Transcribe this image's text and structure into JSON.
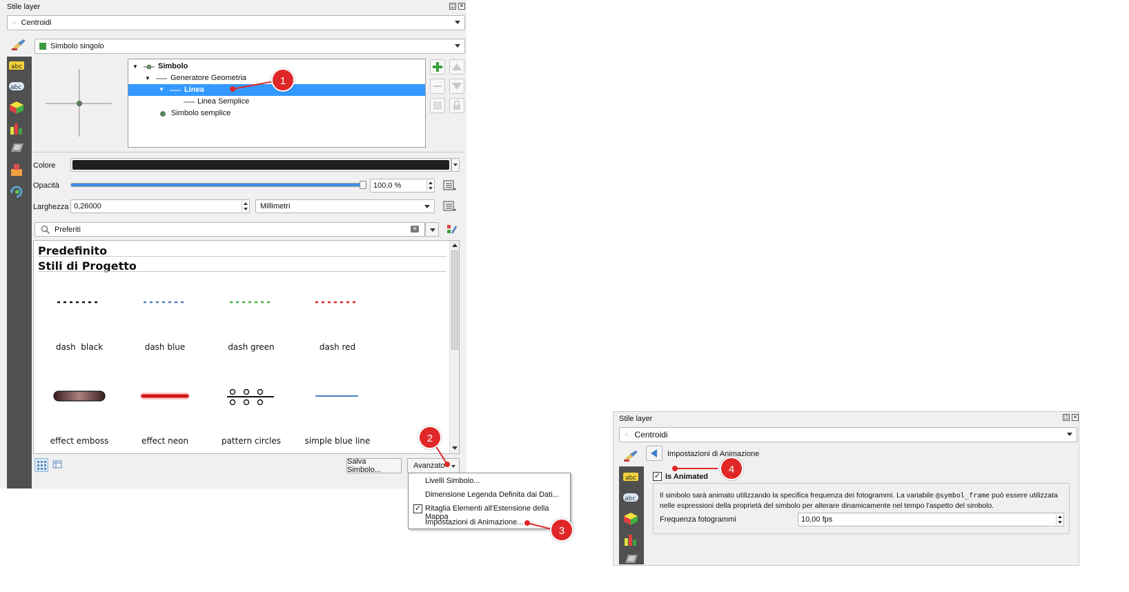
{
  "left_panel": {
    "title": "Stile layer",
    "layer_combo": "Centroidi",
    "renderer_combo": "Simbolo singolo",
    "tree": [
      {
        "label": "Simbolo",
        "bold": true
      },
      {
        "label": "Generatore Geometria"
      },
      {
        "label": "Linea",
        "selected": true
      },
      {
        "label": "Linea Semplice"
      },
      {
        "label": "Simbolo semplice"
      }
    ],
    "colore_label": "Colore",
    "colore_value": "#202020",
    "opacita_label": "Opacità",
    "opacita_value": "100,0 %",
    "opacita_fraction": 1.0,
    "larghezza_label": "Larghezza",
    "larghezza_value": "0,26000",
    "unit_value": "Millimetri",
    "search_value": "Preferiti",
    "groups": [
      "Predefinito",
      "Stili di Progetto"
    ],
    "symbols_row1": [
      "dash  black",
      "dash blue",
      "dash green",
      "dash red"
    ],
    "symbols_row2": [
      "effect emboss",
      "effect neon",
      "pattern circles",
      "simple blue line"
    ],
    "save_symbol": "Salva Simbolo...",
    "advanced": "Avanzato"
  },
  "menu": {
    "items": [
      "Livelli Simbolo...",
      "Dimensione Legenda Definita dai Dati...",
      "Ritaglia Elementi all'Estensione della Mappa",
      "Impostazioni di Animazione..."
    ],
    "checked_index": 2
  },
  "right_panel": {
    "title": "Stile layer",
    "layer_combo": "Centroidi",
    "page_title": "Impostazioni di Animazione",
    "is_animated_label": "Is Animated",
    "is_animated_checked": true,
    "description_1": "Il simbolo sarà animato utilizzando la specifica frequenza dei fotogrammi. La variabile",
    "description_code": "@symbol_frame",
    "description_2": "può essere utilizzata",
    "description_3": "nelle espressioni della proprietà del simbolo per alterare dinamicamente nel tempo l'aspetto del simbolo.",
    "freq_label": "Frequenza fotogrammi",
    "freq_value": "10,00 fps"
  },
  "callouts": [
    "1",
    "2",
    "3",
    "4"
  ],
  "colors": {
    "selection": "#3399ff",
    "callout": "#e02727",
    "sidebar": "#505050",
    "dash_black": "#111111",
    "dash_blue": "#4a7fc0",
    "dash_green": "#3fae3f",
    "dash_red": "#e02020"
  }
}
